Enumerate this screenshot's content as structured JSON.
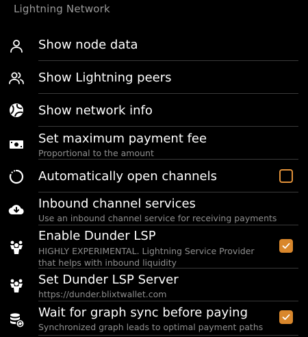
{
  "section": {
    "title": "Lightning Network"
  },
  "colors": {
    "background": "#000000",
    "accent": "#d9872c",
    "divider": "#3a3a3a",
    "subtitle": "#8f8f8f"
  },
  "items": [
    {
      "label": "Show node data",
      "icon": "person-icon"
    },
    {
      "label": "Show Lightning peers",
      "icon": "people-icon"
    },
    {
      "label": "Show network info",
      "icon": "globe-icon"
    },
    {
      "label": "Set maximum payment fee",
      "sub": "Proportional to the amount",
      "icon": "money-icon"
    },
    {
      "label": "Automatically open channels",
      "icon": "loading-circle-icon",
      "checked": false
    },
    {
      "label": "Inbound channel services",
      "sub": "Use an inbound channel service for receiving payments",
      "icon": "cloud-download-icon"
    },
    {
      "label": "Enable Dunder LSP",
      "sub": "HIGHLY EXPERIMENTAL. Lightning Service Provider that helps with inbound liquidity",
      "icon": "lsp-icon",
      "checked": true
    },
    {
      "label": "Set Dunder LSP Server",
      "sub": "https://dunder.blixtwallet.com",
      "icon": "lsp-icon"
    },
    {
      "label": "Wait for graph sync before paying",
      "sub": "Synchronized graph leads to optimal payment paths",
      "icon": "database-sync-icon",
      "checked": true
    }
  ]
}
